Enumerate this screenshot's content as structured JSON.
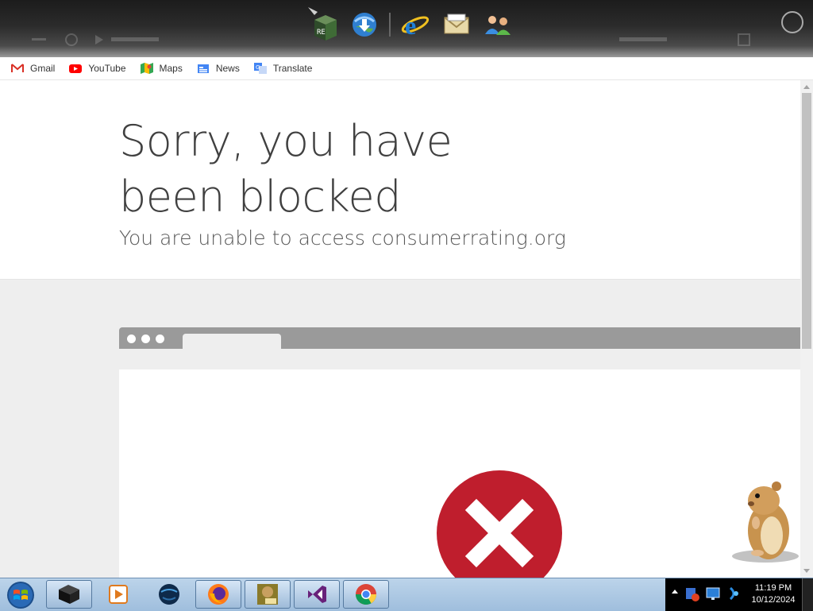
{
  "bookmarks": [
    {
      "label": "Gmail",
      "icon": "gmail-icon"
    },
    {
      "label": "YouTube",
      "icon": "youtube-icon"
    },
    {
      "label": "Maps",
      "icon": "maps-icon"
    },
    {
      "label": "News",
      "icon": "news-icon"
    },
    {
      "label": "Translate",
      "icon": "translate-icon"
    }
  ],
  "dock": [
    "cube-app-icon",
    "globe-download-icon",
    "internet-explorer-icon",
    "mail-envelope-icon",
    "users-icon"
  ],
  "page": {
    "headline": "Sorry, you have been blocked",
    "subline": "You are unable to access consumerrating.org"
  },
  "taskbar": {
    "apps": [
      "black-box-icon",
      "media-player-icon",
      "globe-app-icon",
      "firefox-icon",
      "box-game-icon",
      "visual-studio-icon",
      "chrome-icon"
    ],
    "time": "11:19 PM",
    "date": "10/12/2024"
  },
  "colors": {
    "error_red": "#bf1e2d",
    "taskbar": "#a8c4e0",
    "headline_text": "#404040"
  }
}
